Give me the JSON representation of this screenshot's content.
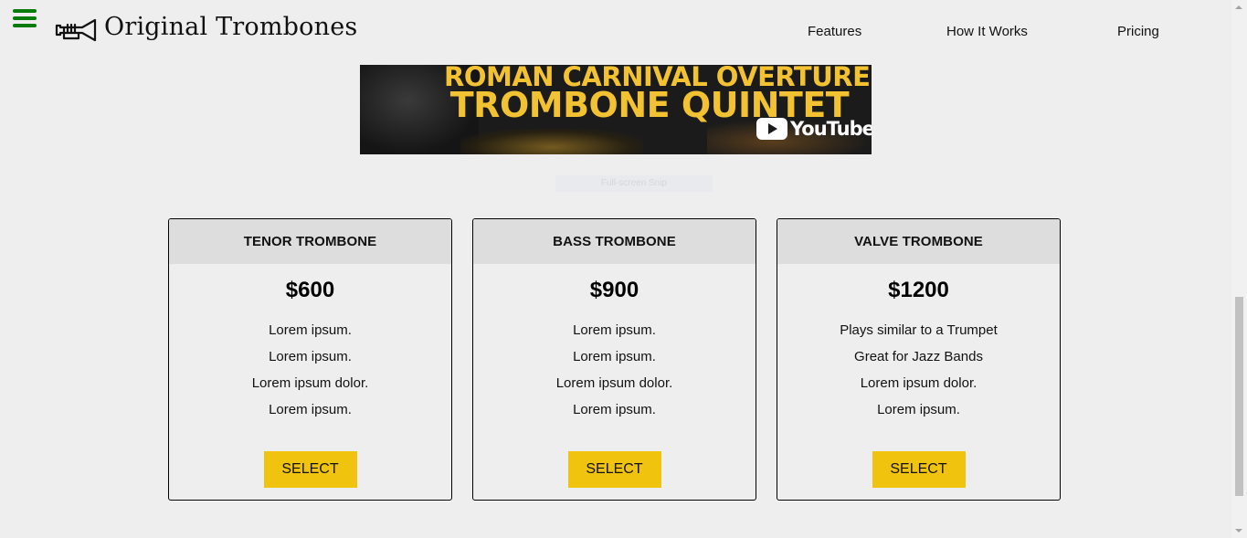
{
  "header": {
    "brand": "Original Trombones",
    "nav": [
      "Features",
      "How It Works",
      "Pricing"
    ]
  },
  "video": {
    "title_line_1": "ROMAN CARNIVAL OVERTURE",
    "title_line_2": "TROMBONE QUINTET",
    "provider": "YouTube"
  },
  "snip_label": "Full-screen Snip",
  "pricing": [
    {
      "name": "TENOR TROMBONE",
      "price": "$600",
      "features": [
        "Lorem ipsum.",
        "Lorem ipsum.",
        "Lorem ipsum dolor.",
        "Lorem ipsum."
      ],
      "button": "SELECT"
    },
    {
      "name": "BASS TROMBONE",
      "price": "$900",
      "features": [
        "Lorem ipsum.",
        "Lorem ipsum.",
        "Lorem ipsum dolor.",
        "Lorem ipsum."
      ],
      "button": "SELECT"
    },
    {
      "name": "VALVE TROMBONE",
      "price": "$1200",
      "features": [
        "Plays similar to a Trumpet",
        "Great for Jazz Bands",
        "Lorem ipsum dolor.",
        "Lorem ipsum."
      ],
      "button": "SELECT"
    }
  ],
  "colors": {
    "background": "#eeeeee",
    "hamburger": "#0a7a0a",
    "card_header": "#dddddd",
    "button": "#f0c30e",
    "video_title": "#f2c232"
  },
  "icons": {
    "menu": "hamburger-icon",
    "logo": "trumpet-icon",
    "video_provider": "youtube-play-icon"
  }
}
